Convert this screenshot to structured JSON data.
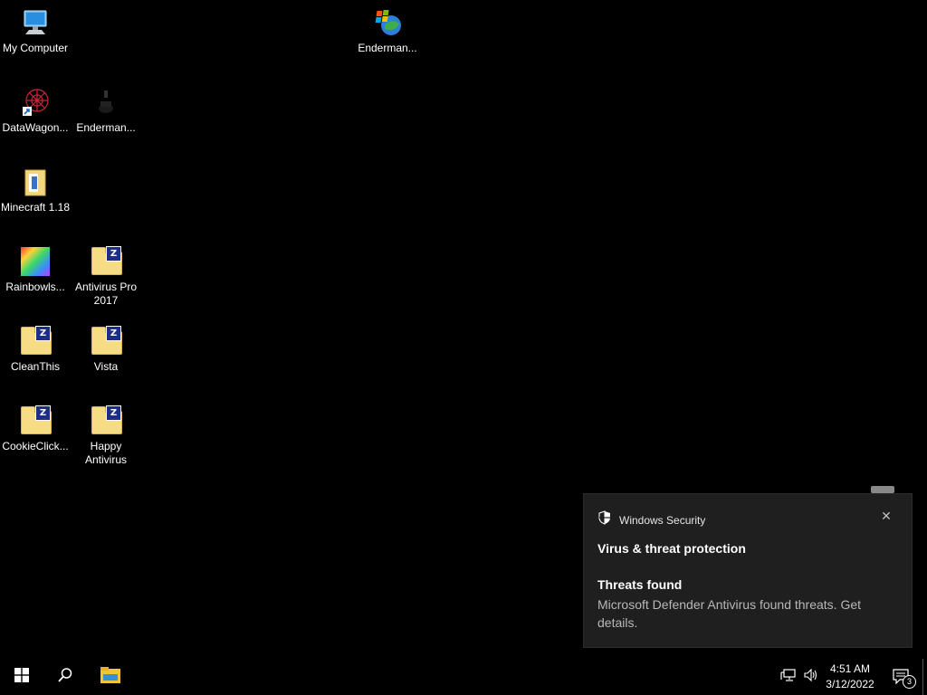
{
  "desktop": {
    "icons": [
      {
        "label": "My Computer",
        "icon": "my-computer-icon"
      },
      {
        "label": "Enderman...",
        "icon": "windows-flag-globe-icon"
      },
      {
        "label": "DataWagon...",
        "icon": "datawagon-shortcut-icon"
      },
      {
        "label": "Enderman...",
        "icon": "enderman-icon"
      },
      {
        "label": "Minecraft 1.18",
        "icon": "minecraft-folder-icon"
      },
      {
        "label": "Rainbowls...",
        "icon": "rainbow-image-icon"
      },
      {
        "label": "Antivirus Pro 2017",
        "icon": "zip-folder-icon"
      },
      {
        "label": "CleanThis",
        "icon": "zip-folder-icon"
      },
      {
        "label": "Vista",
        "icon": "zip-folder-icon"
      },
      {
        "label": "CookieClick...",
        "icon": "zip-folder-icon"
      },
      {
        "label": "Happy Antivirus",
        "icon": "zip-folder-icon"
      }
    ]
  },
  "toast": {
    "app_name": "Windows Security",
    "header": "Virus & threat protection",
    "title": "Threats found",
    "body": "Microsoft Defender Antivirus found threats. Get details.",
    "close_symbol": "✕"
  },
  "taskbar": {
    "time": "4:51 AM",
    "date": "3/12/2022",
    "notification_count": "3"
  },
  "colors": {
    "desktop_bg": "#000000",
    "toast_bg": "#1f1f1f",
    "folder": "#f6dd85",
    "zip_badge": "#1f2d8a"
  }
}
